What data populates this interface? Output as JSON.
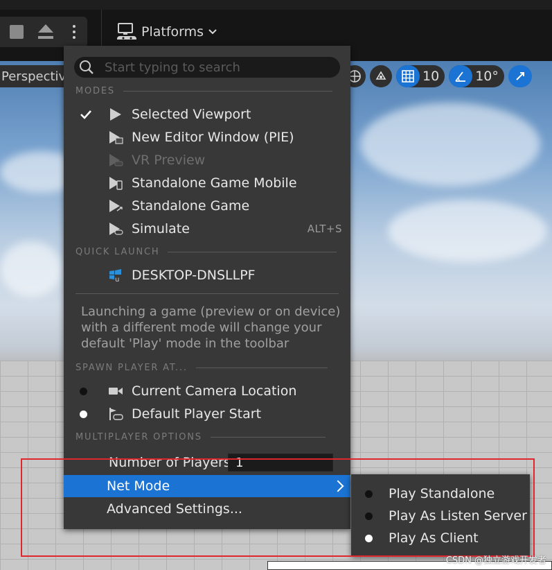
{
  "toolbar": {
    "platforms_label": "Platforms"
  },
  "viewport": {
    "perspective_label": "Perspectiv",
    "grid_snap_value": "10",
    "rotation_snap_value": "10°"
  },
  "menu": {
    "search_placeholder": "Start typing to search",
    "sections": {
      "modes": "MODES",
      "quick_launch": "QUICK LAUNCH",
      "spawn": "SPAWN PLAYER AT...",
      "multiplayer": "MULTIPLAYER OPTIONS"
    },
    "modes": [
      {
        "label": "Selected Viewport",
        "checked": true,
        "icon": "play-icon"
      },
      {
        "label": "New Editor Window (PIE)",
        "icon": "new-window-play-icon"
      },
      {
        "label": "VR Preview",
        "disabled": true,
        "icon": "vr-play-icon"
      },
      {
        "label": "Standalone Game Mobile",
        "icon": "mobile-play-icon"
      },
      {
        "label": "Standalone Game",
        "icon": "standalone-play-icon"
      },
      {
        "label": "Simulate",
        "shortcut": "ALT+S",
        "icon": "simulate-icon"
      }
    ],
    "quick_launch": [
      {
        "label": "DESKTOP-DNSLLPF",
        "icon": "windows-device-icon"
      }
    ],
    "info_text": "Launching a game (preview or on device) with a different mode will change your default 'Play' mode in the toolbar",
    "spawn": [
      {
        "label": "Current Camera Location",
        "selected": false,
        "icon": "camera-icon"
      },
      {
        "label": "Default Player Start",
        "selected": true,
        "icon": "player-start-icon"
      }
    ],
    "multiplayer": {
      "num_players_label": "Number of Players",
      "num_players_value": "1",
      "net_mode_label": "Net Mode",
      "advanced_label": "Advanced Settings..."
    }
  },
  "submenu": {
    "items": [
      {
        "label": "Play Standalone",
        "selected": false
      },
      {
        "label": "Play As Listen Server",
        "selected": false
      },
      {
        "label": "Play As Client",
        "selected": true
      }
    ]
  },
  "watermark": "CSDN @独立游戏开发者",
  "colors": {
    "accent": "#1b73d3",
    "highlight_border": "#e0262d",
    "menu_bg": "#383838"
  }
}
